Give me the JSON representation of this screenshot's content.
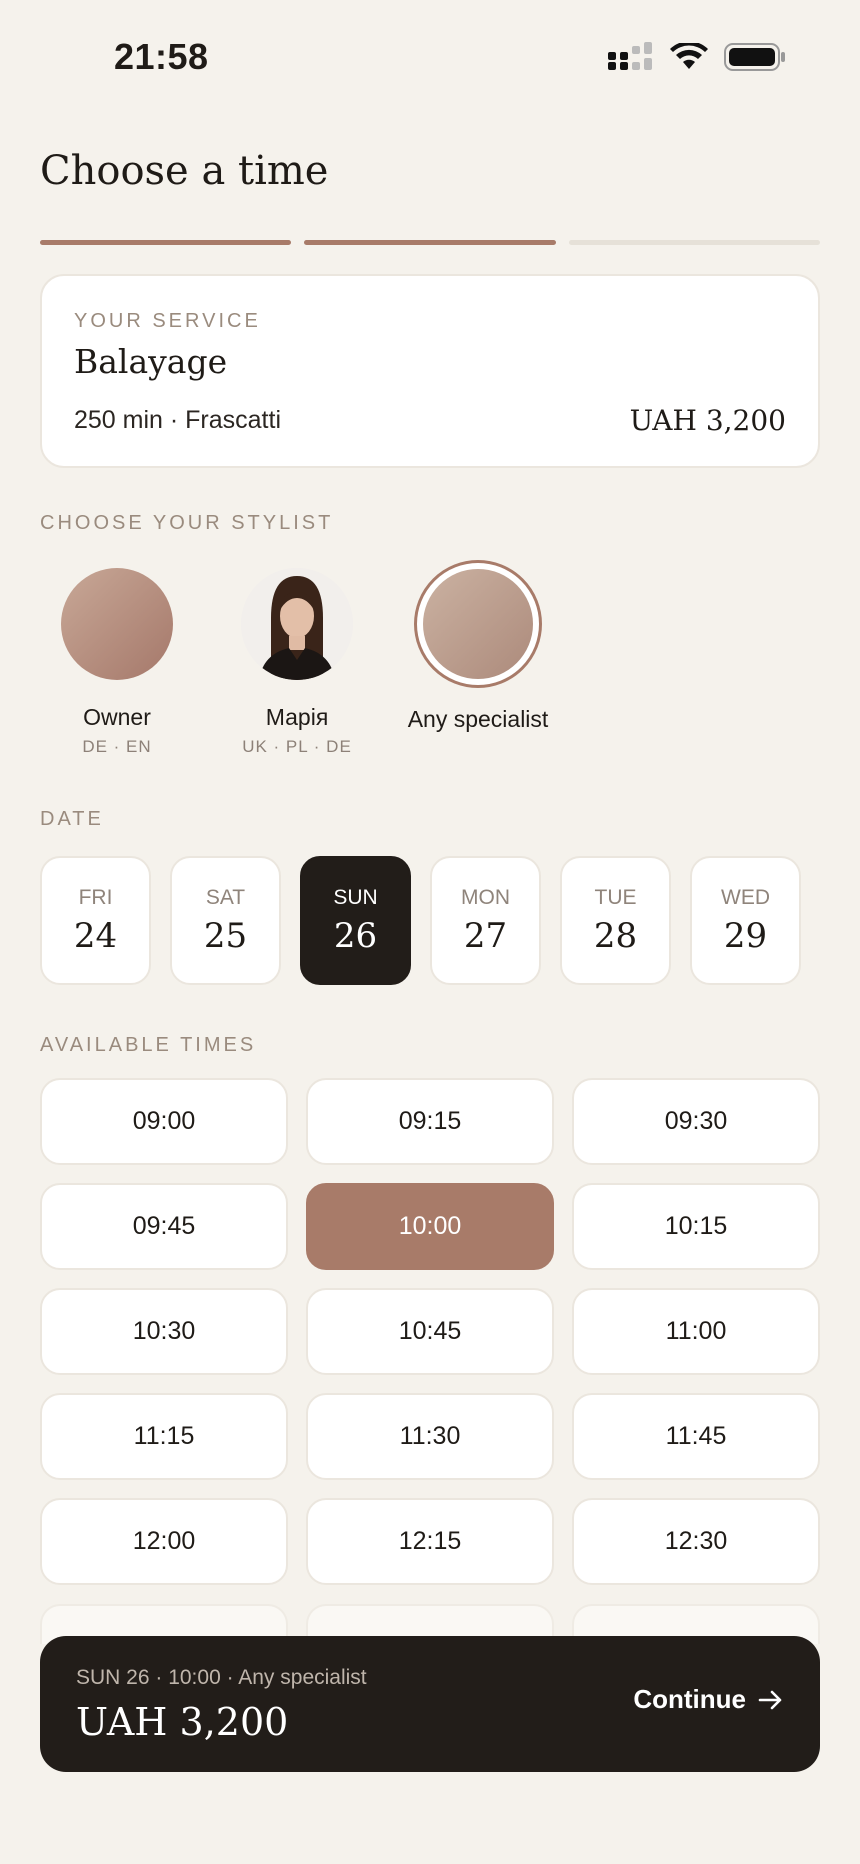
{
  "status": {
    "time": "21:58"
  },
  "title": "Choose a time",
  "progress": {
    "steps": 3,
    "completed": 2
  },
  "service": {
    "label": "YOUR SERVICE",
    "name": "Balayage",
    "meta": "250 min · Frascatti",
    "price": "UAH 3,200"
  },
  "stylists": {
    "label": "CHOOSE YOUR STYLIST",
    "items": [
      {
        "name": "Owner",
        "langs": "DE · EN"
      },
      {
        "name": "Марія",
        "langs": "UK · PL · DE"
      },
      {
        "name": "Any specialist",
        "langs": ""
      }
    ]
  },
  "date": {
    "label": "DATE",
    "items": [
      {
        "dow": "FRI",
        "day": "24"
      },
      {
        "dow": "SAT",
        "day": "25"
      },
      {
        "dow": "SUN",
        "day": "26"
      },
      {
        "dow": "MON",
        "day": "27"
      },
      {
        "dow": "TUE",
        "day": "28"
      },
      {
        "dow": "WED",
        "day": "29"
      }
    ]
  },
  "times": {
    "label": "AVAILABLE TIMES",
    "slots": [
      "09:00",
      "09:15",
      "09:30",
      "09:45",
      "10:00",
      "10:15",
      "10:30",
      "10:45",
      "11:00",
      "11:15",
      "11:30",
      "11:45",
      "12:00",
      "12:15",
      "12:30"
    ]
  },
  "summary": {
    "line": "SUN 26 · 10:00 · Any specialist",
    "price": "UAH 3,200",
    "continue_label": "Continue"
  },
  "colors": {
    "accent": "#a87b69",
    "dark": "#221d19",
    "background": "#f5f2ec"
  }
}
